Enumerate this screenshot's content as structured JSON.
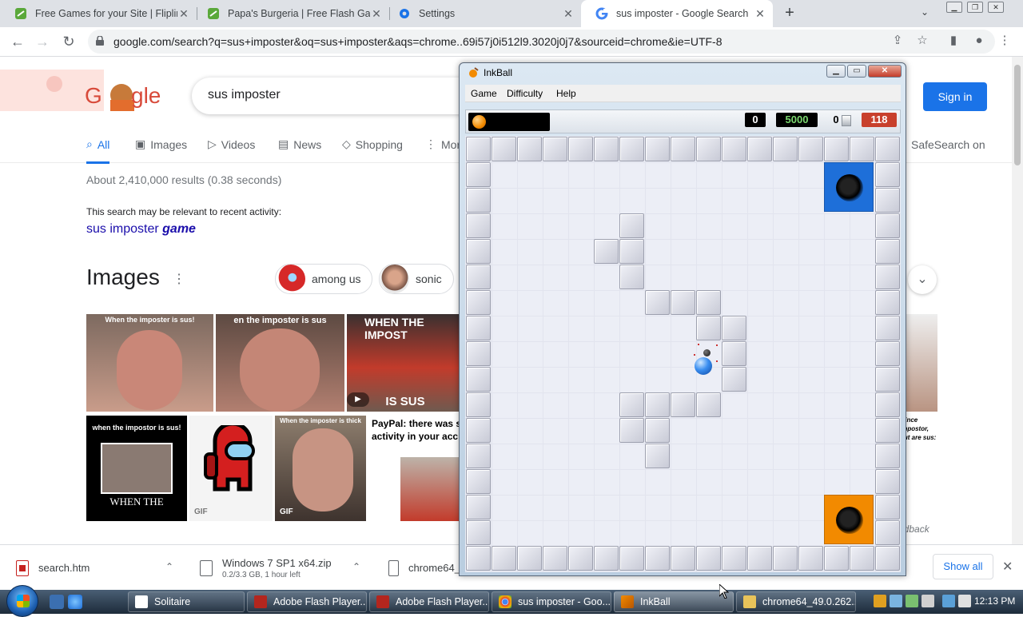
{
  "browser": {
    "tabs": [
      {
        "title": "Free Games for your Site | Flipline",
        "icon": "flipline-icon"
      },
      {
        "title": "Papa's Burgeria | Free Flash Game",
        "icon": "flipline-icon"
      },
      {
        "title": "Settings",
        "icon": "gear-icon"
      },
      {
        "title": "sus imposter - Google Search",
        "icon": "google-icon"
      }
    ],
    "url": "google.com/search?q=sus+imposter&oq=sus+imposter&aqs=chrome..69i57j0i512l9.3020j0j7&sourceid=chrome&ie=UTF-8"
  },
  "google": {
    "query": "sus imposter",
    "sign_in": "Sign in",
    "tabs": [
      {
        "label": "All",
        "icon": "search-icon"
      },
      {
        "label": "Images",
        "icon": "image-icon"
      },
      {
        "label": "Videos",
        "icon": "video-icon"
      },
      {
        "label": "News",
        "icon": "news-icon"
      },
      {
        "label": "Shopping",
        "icon": "tag-icon"
      },
      {
        "label": "More",
        "icon": "more-icon"
      }
    ],
    "safesearch": "SafeSearch on",
    "stats": "About 2,410,000 results (0.38 seconds)",
    "relevant_note": "This search may be relevant to recent activity:",
    "relevant_link": {
      "prefix": "sus imposter ",
      "emphasis": "game"
    },
    "images_heading": "Images",
    "chips": [
      "among us",
      "sonic"
    ],
    "thumb_captions": [
      "When the imposter is sus!",
      "en the imposter is sus",
      "WHEN THE IMPOST",
      "IS SUS",
      "when the impostor is sus!",
      "WHEN THE",
      "When the imposter is thick",
      "PayPal: there was s activity in your acc me:",
      "wince impostor, but are sus:"
    ],
    "gif_label": "GIF",
    "feedback": "edback"
  },
  "downloads": [
    {
      "name": "search.htm",
      "sub": ""
    },
    {
      "name": "Windows 7 SP1 x64.zip",
      "sub": "0.2/3.3 GB, 1 hour left"
    },
    {
      "name": "chrome64_",
      "sub": ""
    }
  ],
  "show_all": "Show all",
  "taskbar": {
    "tasks": [
      "Solitaire",
      "Adobe Flash Player...",
      "Adobe Flash Player...",
      "sus imposter - Goo...",
      "InkBall",
      "chrome64_49.0.262..."
    ],
    "clock": "12:13 PM"
  },
  "inkball": {
    "title": "InkBall",
    "menu": [
      "Game",
      "Difficulty",
      "Help"
    ],
    "scores": {
      "left": "0",
      "target": "5000",
      "balls": "0",
      "timer": "118"
    },
    "colors": {
      "blue": "#1e6fd9",
      "orange": "#f28a00",
      "score_green": "#7bd86f",
      "timer_bg": "#c8402c"
    }
  }
}
